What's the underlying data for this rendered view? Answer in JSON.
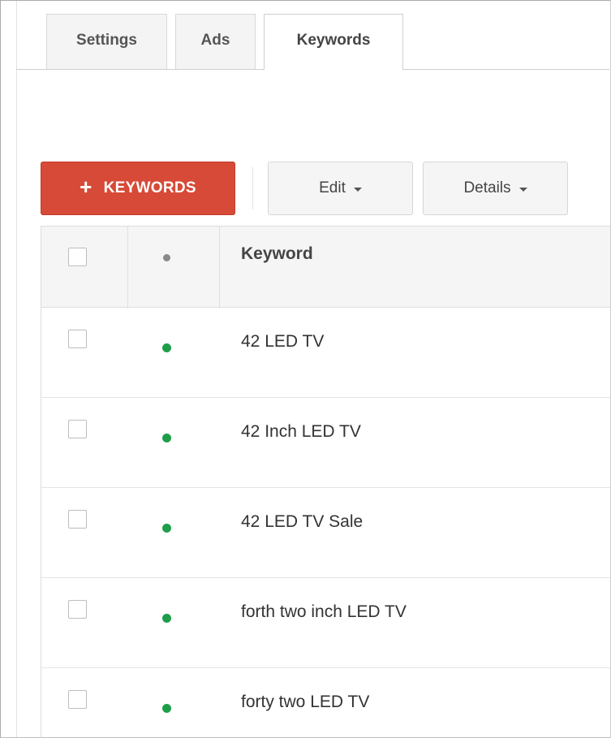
{
  "tabs": [
    {
      "label": "Settings",
      "active": false
    },
    {
      "label": "Ads",
      "active": false
    },
    {
      "label": "Keywords",
      "active": true
    }
  ],
  "toolbar": {
    "add_keywords_label": "KEYWORDS",
    "edit_label": "Edit",
    "details_label": "Details"
  },
  "table": {
    "header": {
      "keyword": "Keyword"
    },
    "rows": [
      {
        "keyword": "42 LED TV",
        "status": "enabled"
      },
      {
        "keyword": "42 Inch LED TV",
        "status": "enabled"
      },
      {
        "keyword": "42 LED TV Sale",
        "status": "enabled"
      },
      {
        "keyword": "forth two inch LED TV",
        "status": "enabled"
      },
      {
        "keyword": "forty two LED TV",
        "status": "enabled"
      }
    ]
  },
  "colors": {
    "accent_red": "#d74a37",
    "status_green": "#1e9e4a",
    "status_header_grey": "#8a8a8a"
  }
}
